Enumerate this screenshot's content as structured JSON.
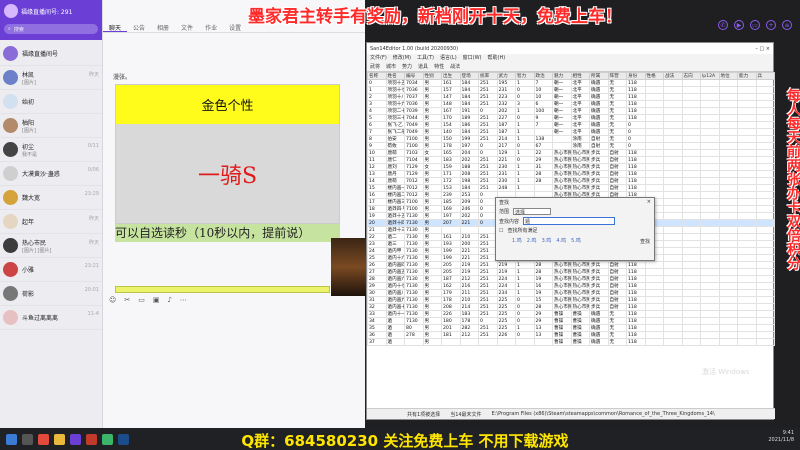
{
  "banner_top": "墨家君主转手有奖励，新档刚开十天，免费上车！",
  "banner_bottom": "Q群：684580230 关注免费上车 不用下载游戏",
  "banner_side": "每人每天前两张办卡双倍积分",
  "sidebar": {
    "title": "福缘直播间号: 291",
    "search_placeholder": "搜索",
    "chats": [
      {
        "name": "福缘直播间号",
        "msg": "",
        "time": "",
        "color": "#8a6cd8"
      },
      {
        "name": "林凯",
        "msg": "[图片]",
        "time": "昨天",
        "color": "#6b80c9"
      },
      {
        "name": "始初",
        "msg": "",
        "time": "",
        "color": "#d2e0ef"
      },
      {
        "name": "柚阳",
        "msg": "[图片]",
        "time": "",
        "color": "#b38a6a"
      },
      {
        "name": "初尘",
        "msg": "我不是",
        "time": "0/11",
        "color": "#444"
      },
      {
        "name": "大漠黄沙·蛊惑",
        "msg": "",
        "time": "0/06",
        "color": "#cfcfcf"
      },
      {
        "name": "魏大宽",
        "msg": "",
        "time": "23:29",
        "color": "#d4a33a"
      },
      {
        "name": "起年",
        "msg": "",
        "time": "昨天",
        "color": "#e4d6c1"
      },
      {
        "name": "热心市民",
        "msg": "[图片] [图片]",
        "time": "昨天",
        "color": "#3c3c3c"
      },
      {
        "name": "小雅",
        "msg": "",
        "time": "23:21",
        "color": "#c44"
      },
      {
        "name": "荷影",
        "msg": "",
        "time": "20:01",
        "color": "#777"
      },
      {
        "name": "斗鱼过离离离",
        "msg": "",
        "time": "11-4",
        "color": "#e7c1c1"
      }
    ]
  },
  "chat": {
    "tabs": [
      "聊天",
      "公告",
      "相册",
      "文件",
      "作业",
      "设置"
    ],
    "greeting": "漫张。",
    "gold_title": "金色个性",
    "center_text": "一骑S",
    "green_text": "可以自选读秒（10秒以内，提前说）"
  },
  "editor": {
    "title": "San14Editor 1.00 (build 20200930)",
    "menu": [
      "文件(F)",
      "修改(M)",
      "工具(T)",
      "语言(L)",
      "窗口(W)",
      "帮助(H)"
    ],
    "toolbar": [
      "武将",
      "城市",
      "势力",
      "道具",
      "特性",
      "战法"
    ],
    "columns": [
      "名称",
      "姓名",
      "编号",
      "性别",
      "出生",
      "登场",
      "统率",
      "武力",
      "智力",
      "政治",
      "魅力",
      "相性",
      "所属",
      "阵营",
      "身份",
      "性格",
      "战法",
      "志向",
      "lp12A",
      "地位",
      "能力",
      "兵"
    ],
    "rows": [
      [
        "0",
        "项羽十五",
        "7034",
        "男",
        "161",
        "184",
        "251",
        "195",
        "1",
        "7",
        "朝一",
        "北平",
        "确遇",
        "无",
        "118",
        "",
        "",
        "",
        "",
        "",
        "",
        ""
      ],
      [
        "1",
        "项羽十七",
        "7036",
        "男",
        "157",
        "184",
        "251",
        "231",
        "0",
        "10",
        "朝一",
        "北平",
        "确遇",
        "无",
        "118",
        "",
        "",
        "",
        "",
        "",
        "",
        ""
      ],
      [
        "2",
        "项羽十八",
        "7037",
        "男",
        "147",
        "184",
        "251",
        "223",
        "0",
        "10",
        "朝一",
        "北平",
        "确遇",
        "无",
        "118",
        "",
        "",
        "",
        "",
        "",
        "",
        ""
      ],
      [
        "3",
        "项羽十九",
        "7036",
        "男",
        "148",
        "184",
        "251",
        "232",
        "3",
        "6",
        "朝一",
        "北平",
        "确遇",
        "无",
        "118",
        "",
        "",
        "",
        "",
        "",
        "",
        ""
      ],
      [
        "4",
        "项羽二十",
        "7039",
        "男",
        "167",
        "191",
        "0",
        "202",
        "1",
        "100",
        "朝一",
        "北平",
        "确遇",
        "无",
        "118",
        "",
        "",
        "",
        "",
        "",
        "",
        ""
      ],
      [
        "5",
        "项羽三十",
        "7044",
        "男",
        "170",
        "189",
        "251",
        "227",
        "0",
        "9",
        "朝一",
        "北平",
        "确遇",
        "无",
        "118",
        "",
        "",
        "",
        "",
        "",
        "",
        ""
      ],
      [
        "6",
        "张飞·乙",
        "7049",
        "男",
        "154",
        "186",
        "251",
        "187",
        "1",
        "7",
        "朝一",
        "北平",
        "确遇",
        "无",
        "0",
        "",
        "",
        "",
        "",
        "",
        "",
        ""
      ],
      [
        "7",
        "张飞二乐",
        "7049",
        "男",
        "140",
        "184",
        "251",
        "187",
        "1",
        "",
        "朝一",
        "北平",
        "确遇",
        "无",
        "0",
        "",
        "",
        "",
        "",
        "",
        "",
        ""
      ],
      [
        "8",
        "伯安",
        "7100",
        "男",
        "150",
        "199",
        "251",
        "214",
        "1",
        "138",
        "",
        "涂南",
        "自射",
        "无",
        "0",
        "",
        "",
        "",
        "",
        "",
        "",
        ""
      ],
      [
        "9",
        "荀攸",
        "7100",
        "男",
        "178",
        "197",
        "0",
        "217",
        "0",
        "67",
        "",
        "涂南",
        "自射",
        "无",
        "0",
        "",
        "",
        "",
        "",
        "",
        "",
        ""
      ],
      [
        "10",
        "唐萌",
        "7103",
        "女",
        "165",
        "204",
        "0",
        "129",
        "1",
        "22",
        "热心市民",
        "热心市民",
        "步兵",
        "自射",
        "118",
        "",
        "",
        "",
        "",
        "",
        "",
        ""
      ],
      [
        "11",
        "唐仁",
        "7104",
        "男",
        "183",
        "202",
        "251",
        "221",
        "0",
        "29",
        "热心市民",
        "热心市民",
        "步兵",
        "自射",
        "118",
        "",
        "",
        "",
        "",
        "",
        "",
        ""
      ],
      [
        "12",
        "唐刘",
        "7129",
        "女",
        "159",
        "188",
        "251",
        "230",
        "1",
        "31",
        "热心市民",
        "热心市民",
        "步兵",
        "自射",
        "118",
        "",
        "",
        "",
        "",
        "",
        "",
        ""
      ],
      [
        "13",
        "唐丹",
        "7129",
        "男",
        "171",
        "208",
        "251",
        "231",
        "1",
        "28",
        "热心市民",
        "热心市民",
        "步兵",
        "自射",
        "118",
        "",
        "",
        "",
        "",
        "",
        "",
        ""
      ],
      [
        "14",
        "唐萌",
        "7012",
        "男",
        "172",
        "198",
        "251",
        "230",
        "1",
        "28",
        "热心市民",
        "热心市民",
        "步兵",
        "自射",
        "118",
        "",
        "",
        "",
        "",
        "",
        "",
        ""
      ],
      [
        "15",
        "楼内画一",
        "7012",
        "男",
        "153",
        "184",
        "251",
        "248",
        "1",
        "",
        "热心市民",
        "热心市民",
        "步兵",
        "自射",
        "118",
        "",
        "",
        "",
        "",
        "",
        "",
        ""
      ],
      [
        "16",
        "楼内画二",
        "7012",
        "男",
        "239",
        "253",
        "0",
        "",
        "",
        "",
        "热心市民",
        "热心市民",
        "步兵",
        "自射",
        "118",
        "",
        "",
        "",
        "",
        "",
        "",
        ""
      ],
      [
        "17",
        "楼内画三",
        "7100",
        "男",
        "185",
        "209",
        "0",
        "",
        "",
        "",
        "热心市民",
        "热心市民",
        "步兵",
        "自射",
        "118",
        "",
        "",
        "",
        "",
        "",
        "",
        ""
      ],
      [
        "18",
        "遁莽四·甲",
        "7100",
        "男",
        "169",
        "246",
        "0",
        "",
        "",
        "",
        "热心市民",
        "热心市民",
        "步兵",
        "自射",
        "118",
        "",
        "",
        "",
        "",
        "",
        "",
        ""
      ],
      [
        "19",
        "遁莽十五",
        "7130",
        "男",
        "197",
        "202",
        "0",
        "",
        "",
        "",
        "热心市民",
        "热心市民",
        "步兵",
        "自射",
        "118",
        "",
        "",
        "",
        "",
        "",
        "",
        ""
      ],
      [
        "20",
        "遁莽十四",
        "7130",
        "男",
        "207",
        "221",
        "0",
        "",
        "",
        "",
        "热心市民",
        "热心市民",
        "步兵",
        "自射",
        "118",
        "",
        "",
        "",
        "",
        "",
        "",
        ""
      ],
      [
        "21",
        "遁莽十三",
        "7130",
        "男",
        "",
        "",
        "",
        "",
        "",
        "",
        "热心市民",
        "热心市民",
        "步兵",
        "自射",
        "118",
        "",
        "",
        "",
        "",
        "",
        "",
        ""
      ],
      [
        "22",
        "遁二",
        "7130",
        "男",
        "161",
        "210",
        "251",
        "237",
        "0",
        "12",
        "热心市民",
        "热心市民",
        "步兵",
        "自射",
        "118",
        "",
        "",
        "",
        "",
        "",
        "",
        ""
      ],
      [
        "23",
        "遁三",
        "7130",
        "男",
        "193",
        "200",
        "251",
        "230",
        "0",
        "11",
        "热心市民",
        "热心市民",
        "步兵",
        "自射",
        "118",
        "",
        "",
        "",
        "",
        "",
        "",
        ""
      ],
      [
        "24",
        "遁内甲",
        "7130",
        "男",
        "199",
        "221",
        "251",
        "237",
        "1",
        "",
        "热心市民",
        "热心市民",
        "步兵",
        "自射",
        "118",
        "",
        "",
        "",
        "",
        "",
        "",
        ""
      ],
      [
        "25",
        "遁内十六",
        "7130",
        "男",
        "199",
        "221",
        "251",
        "211",
        "1",
        "",
        "热心市民",
        "热心市民",
        "步兵",
        "自射",
        "118",
        "",
        "",
        "",
        "",
        "",
        "",
        ""
      ],
      [
        "26",
        "遁内画四",
        "7130",
        "男",
        "205",
        "219",
        "251",
        "219",
        "1",
        "28",
        "热心市民",
        "热心市民",
        "步兵",
        "自射",
        "118",
        "",
        "",
        "",
        "",
        "",
        "",
        ""
      ],
      [
        "27",
        "遁内画五",
        "7130",
        "男",
        "205",
        "219",
        "251",
        "219",
        "1",
        "28",
        "热心市民",
        "热心市民",
        "步兵",
        "自射",
        "118",
        "",
        "",
        "",
        "",
        "",
        "",
        ""
      ],
      [
        "28",
        "遁内画六",
        "7130",
        "男",
        "187",
        "212",
        "251",
        "224",
        "1",
        "19",
        "热心市民",
        "热心市民",
        "步兵",
        "自射",
        "118",
        "",
        "",
        "",
        "",
        "",
        "",
        ""
      ],
      [
        "29",
        "遁内十七",
        "7130",
        "男",
        "162",
        "216",
        "251",
        "224",
        "1",
        "16",
        "热心市民",
        "热心市民",
        "步兵",
        "自射",
        "118",
        "",
        "",
        "",
        "",
        "",
        "",
        ""
      ],
      [
        "30",
        "遁内画八",
        "7130",
        "男",
        "179",
        "211",
        "251",
        "234",
        "1",
        "19",
        "热心市民",
        "热心市民",
        "步兵",
        "自射",
        "118",
        "",
        "",
        "",
        "",
        "",
        "",
        ""
      ],
      [
        "31",
        "遁内画九",
        "7130",
        "男",
        "178",
        "210",
        "251",
        "225",
        "0",
        "15",
        "热心市民",
        "热心市民",
        "步兵",
        "自射",
        "118",
        "",
        "",
        "",
        "",
        "",
        "",
        ""
      ],
      [
        "32",
        "遁内画十",
        "7130",
        "男",
        "208",
        "214",
        "251",
        "225",
        "0",
        "28",
        "热心市民",
        "热心市民",
        "步兵",
        "自射",
        "118",
        "",
        "",
        "",
        "",
        "",
        "",
        ""
      ],
      [
        "33",
        "遁内十一",
        "7130",
        "男",
        "226",
        "183",
        "251",
        "225",
        "0",
        "29",
        "曹操",
        "曹操",
        "确遇",
        "无",
        "118",
        "",
        "",
        "",
        "",
        "",
        "",
        ""
      ],
      [
        "34",
        "遁",
        "7130",
        "男",
        "180",
        "178",
        "0",
        "225",
        "0",
        "29",
        "曹操",
        "曹操",
        "确遇",
        "无",
        "118",
        "",
        "",
        "",
        "",
        "",
        "",
        ""
      ],
      [
        "35",
        "遁",
        "80",
        "男",
        "201",
        "282",
        "251",
        "225",
        "1",
        "13",
        "曹操",
        "曹操",
        "确遇",
        "无",
        "118",
        "",
        "",
        "",
        "",
        "",
        "",
        ""
      ],
      [
        "36",
        "遁",
        "278",
        "男",
        "181",
        "212",
        "251",
        "226",
        "0",
        "13",
        "曹操",
        "曹操",
        "确遇",
        "无",
        "118",
        "",
        "",
        "",
        "",
        "",
        "",
        ""
      ],
      [
        "37",
        "遁",
        "",
        "男",
        "",
        "",
        "",
        "",
        "",
        "",
        "曹操",
        "曹操",
        "确遇",
        "无",
        "118",
        "",
        "",
        "",
        "",
        "",
        "",
        ""
      ]
    ],
    "status": [
      "共有1项被选择",
      "当14最末文件",
      "E:\\Program Files (x86)\\Steam\\steamapps\\common\\Romance_of_the_Three_Kingdoms_14\\"
    ]
  },
  "dialog": {
    "title": "查找",
    "scope_label": "范围",
    "scope_value": "选择",
    "find_label": "查找内容",
    "find_value": "遁",
    "checkbox_label": "查找所有满足",
    "button_label": "查找",
    "history": [
      "1.鸣",
      "2.鸣",
      "3.鸣",
      "4.鸣",
      "5.鸣"
    ]
  },
  "watermark": "激活 Windows",
  "clock": {
    "time": "9:41",
    "date": "2021/11/8"
  }
}
